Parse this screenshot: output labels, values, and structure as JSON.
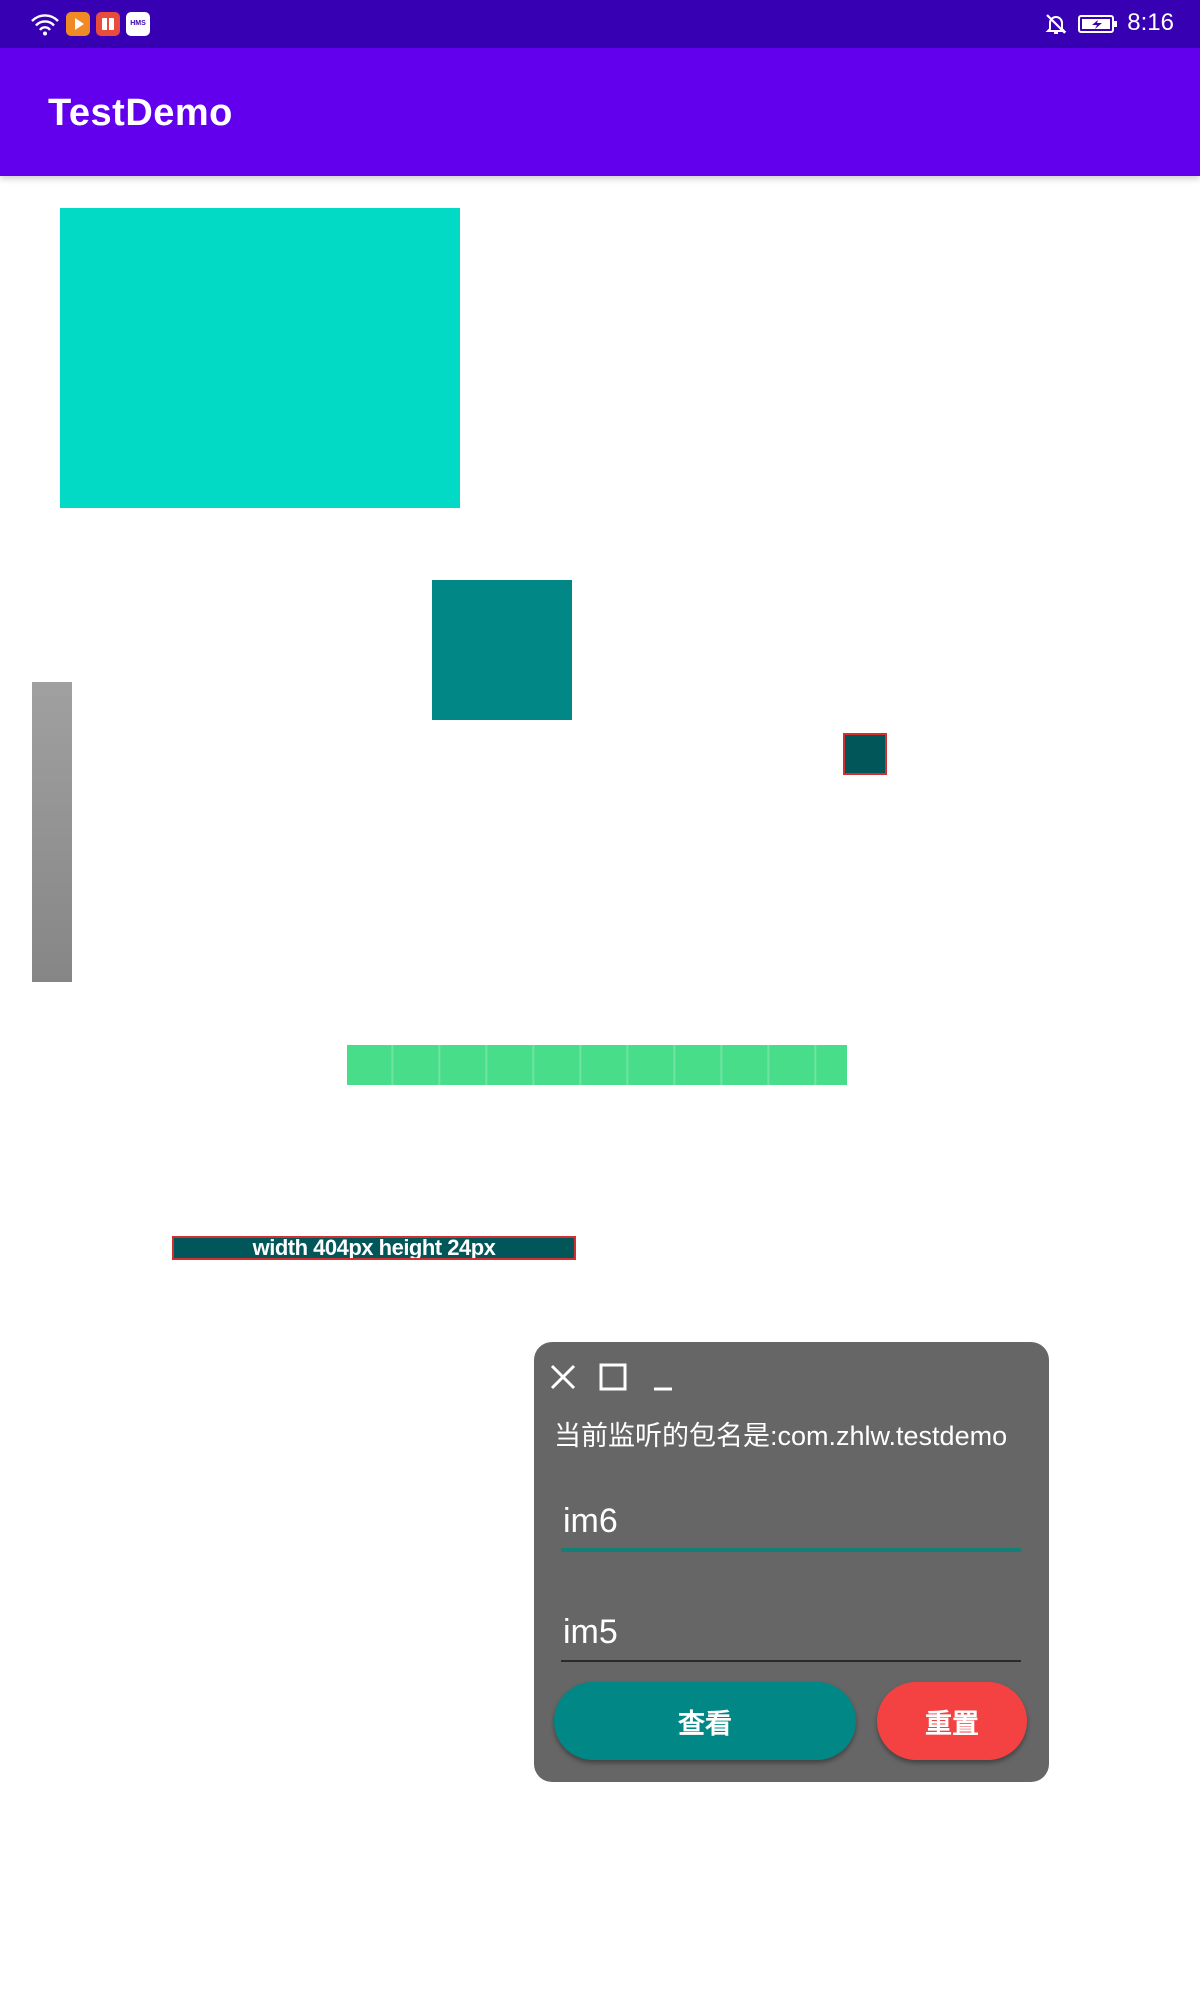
{
  "status_bar": {
    "time": "8:16",
    "left_icons": [
      "wifi-icon",
      "video-app-icon",
      "book-app-icon",
      "hms-app-icon"
    ],
    "hms_label": "HMS",
    "right_icons": [
      "bell-off-icon",
      "battery-charging-icon"
    ]
  },
  "app_bar": {
    "title": "TestDemo"
  },
  "views": {
    "label_text": "width 404px height 24px"
  },
  "panel": {
    "controls": [
      "close-icon",
      "maximize-icon",
      "minimize-icon"
    ],
    "info": "当前监听的包名是:com.zhlw.testdemo",
    "field1_value": "im6",
    "field2_value": "im5",
    "view_button": "查看",
    "reset_button": "重置"
  },
  "colors": {
    "status_bar": "#3700b3",
    "app_bar": "#6200ee",
    "cyan_view": "#03dac5",
    "teal_view": "#018786",
    "dark_teal_view": "#01565a",
    "green_view": "#48dd88",
    "panel_bg": "#666666",
    "view_button": "#018786",
    "reset_button": "#f44242"
  }
}
